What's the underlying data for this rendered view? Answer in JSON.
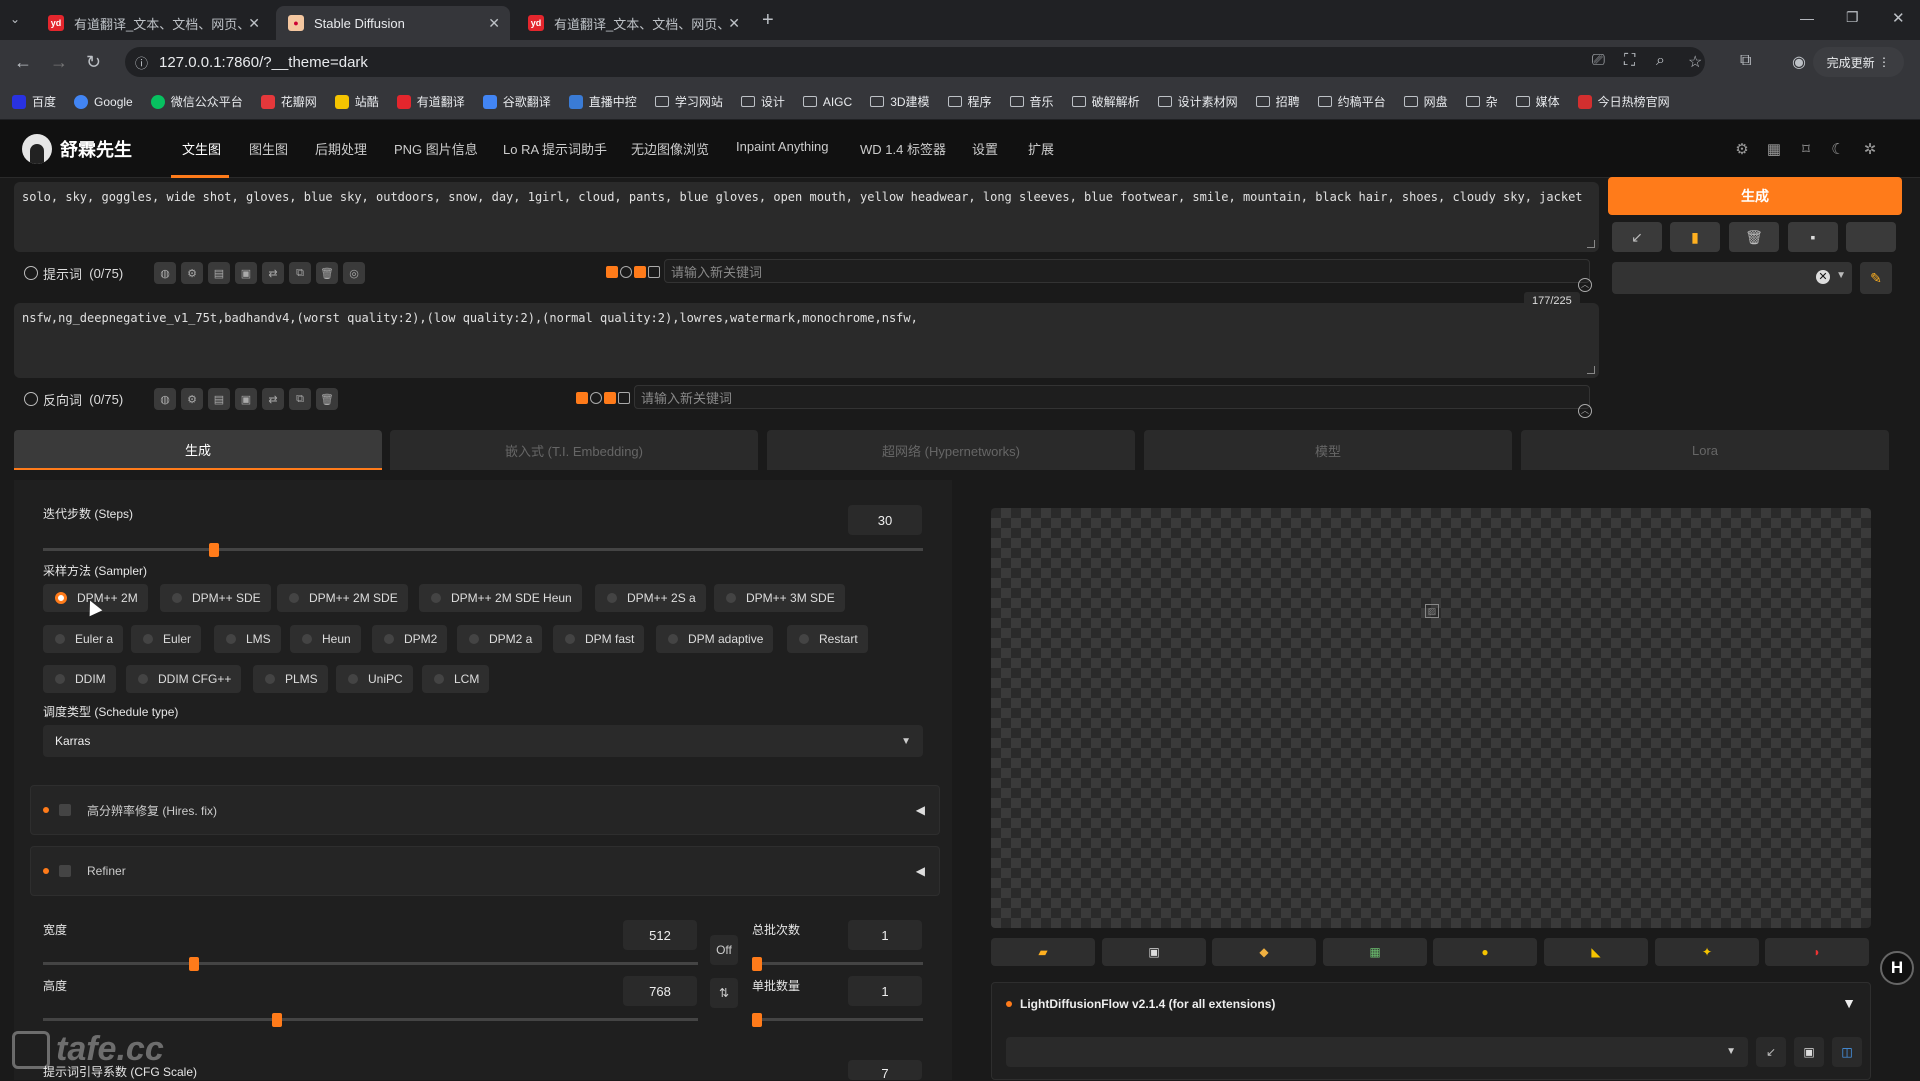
{
  "browser": {
    "tabs": [
      {
        "title": "有道翻译_文本、文档、网页、"
      },
      {
        "title": "Stable Diffusion"
      },
      {
        "title": "有道翻译_文本、文档、网页、"
      }
    ],
    "url": "127.0.0.1:7860/?__theme=dark",
    "update_label": "完成更新",
    "bookmarks": [
      "百度",
      "Google",
      "微信公众平台",
      "花瓣网",
      "站酷",
      "有道翻译",
      "谷歌翻译",
      "直播中控",
      "学习网站",
      "设计",
      "AIGC",
      "3D建模",
      "程序",
      "音乐",
      "破解解析",
      "设计素材网",
      "招聘",
      "约稿平台",
      "网盘",
      "杂",
      "媒体",
      "今日热榜官网"
    ]
  },
  "app": {
    "brand": "舒霖先生",
    "nav": [
      "文生图",
      "图生图",
      "后期处理",
      "PNG 图片信息",
      "Lo RA 提示词助手",
      "无边图像浏览",
      "Inpaint Anything",
      "WD 1.4 标签器",
      "设置",
      "扩展"
    ]
  },
  "prompt": {
    "positive_text": "solo, sky, goggles, wide shot, gloves, blue sky, outdoors, snow, day, 1girl, cloud, pants, blue gloves, open mouth, yellow headwear, long sleeves, blue footwear, smile, mountain, black hair, shoes, cloudy sky, jacket",
    "positive_label": "提示词",
    "positive_count": "(0/75)",
    "keyword_placeholder": "请输入新关键词",
    "token_counter": "177/225",
    "negative_text": "nsfw,ng_deepnegative_v1_75t,badhandv4,(worst quality:2),(low quality:2),(normal quality:2),lowres,watermark,monochrome,nsfw,",
    "negative_label": "反向词",
    "negative_count": "(0/75)"
  },
  "actions": {
    "generate_label": "生成"
  },
  "subtabs": [
    "生成",
    "嵌入式 (T.I. Embedding)",
    "超网络 (Hypernetworks)",
    "模型",
    "Lora"
  ],
  "settings": {
    "steps_label": "迭代步数 (Steps)",
    "steps_value": "30",
    "steps_fraction": 0.194,
    "sampler_label": "采样方法 (Sampler)",
    "samplers_row1": [
      "DPM++ 2M",
      "DPM++ SDE",
      "DPM++ 2M SDE",
      "DPM++ 2M SDE Heun",
      "DPM++ 2S a",
      "DPM++ 3M SDE"
    ],
    "samplers_row2": [
      "Euler a",
      "Euler",
      "LMS",
      "Heun",
      "DPM2",
      "DPM2 a",
      "DPM fast",
      "DPM adaptive",
      "Restart"
    ],
    "samplers_row3": [
      "DDIM",
      "DDIM CFG++",
      "PLMS",
      "UniPC",
      "LCM"
    ],
    "selected_sampler": "DPM++ 2M",
    "schedule_label": "调度类型 (Schedule type)",
    "schedule_value": "Karras",
    "hires_label": "高分辨率修复 (Hires. fix)",
    "refiner_label": "Refiner",
    "width_label": "宽度",
    "width_value": "512",
    "height_label": "高度",
    "height_value": "768",
    "off_label": "Off",
    "batch_count_label": "总批次数",
    "batch_count_value": "1",
    "batch_size_label": "单批数量",
    "batch_size_value": "1",
    "cfg_label": "提示词引导系数 (CFG Scale)",
    "cfg_value": "7"
  },
  "extension": {
    "ldf_title": "LightDiffusionFlow v2.1.4 (for all extensions)"
  },
  "badge": "H",
  "watermark": "tafe.cc",
  "colors": {
    "accent": "#ff7b1a",
    "background": "#1a1a1a",
    "panel": "#2a2a2a"
  }
}
